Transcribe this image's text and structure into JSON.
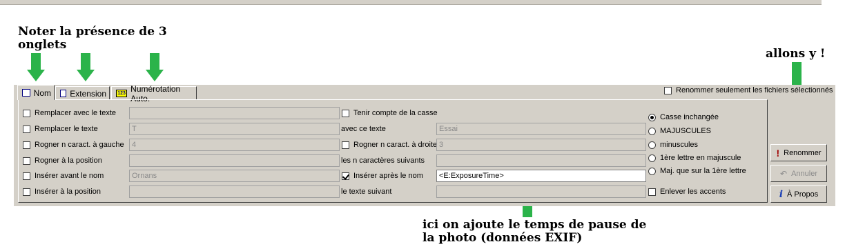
{
  "annotations": {
    "tabs_note": [
      "Noter la présence de 3",
      "onglets"
    ],
    "go_note": "allons y !",
    "exif_note": [
      "ici on ajoute le temps de pause de",
      "la photo (données EXIF)"
    ]
  },
  "colors": {
    "arrow": "#2bb34a",
    "panel": "#d4d0c8"
  },
  "tabs": [
    {
      "label": "Nom",
      "icon": "text-field-icon",
      "active": true
    },
    {
      "label": "Extension",
      "icon": "text-field-icon",
      "active": false
    },
    {
      "label": "Numérotation Auto.",
      "icon": "numbering-icon",
      "icon_text": "123",
      "active": false
    }
  ],
  "only_selected": {
    "label": "Renommer seulement les fichiers sélectionnés",
    "checked": false
  },
  "left_options": [
    {
      "label": "Remplacer avec le texte",
      "checked": false,
      "value": ""
    },
    {
      "label": "Remplacer le texte",
      "checked": false,
      "value": "T"
    },
    {
      "label": "Rogner n caract. à gauche",
      "checked": false,
      "value": "4"
    },
    {
      "label": "Rogner à la position",
      "checked": false,
      "value": ""
    },
    {
      "label": "Insérer avant le nom",
      "checked": false,
      "value": "Ornans"
    },
    {
      "label": "Insérer à la position",
      "checked": false,
      "value": ""
    }
  ],
  "middle_options": [
    {
      "label": "Tenir compte de la casse",
      "checkbox": true,
      "checked": false,
      "value": null
    },
    {
      "label": "avec ce texte",
      "checkbox": false,
      "value": "Essai"
    },
    {
      "label": "Rogner n caract. à droite",
      "checkbox": true,
      "checked": false,
      "value": "3"
    },
    {
      "label": "les n caractères suivants",
      "checkbox": false,
      "value": ""
    },
    {
      "label": "Insérer après le nom",
      "checkbox": true,
      "checked": true,
      "value": "<E:ExposureTime>"
    },
    {
      "label": "le texte suivant",
      "checkbox": false,
      "value": ""
    }
  ],
  "case_options": [
    {
      "label": "Casse inchangée",
      "selected": true
    },
    {
      "label": "MAJUSCULES",
      "selected": false
    },
    {
      "label": "minuscules",
      "selected": false
    },
    {
      "label": "1ère lettre en majuscule",
      "selected": false
    },
    {
      "label": "Maj. que sur la 1ère lettre",
      "selected": false
    }
  ],
  "remove_accents": {
    "label": "Enlever les accents",
    "checked": false
  },
  "buttons": {
    "rename": "Renommer",
    "cancel": "Annuler",
    "about": "À Propos"
  }
}
